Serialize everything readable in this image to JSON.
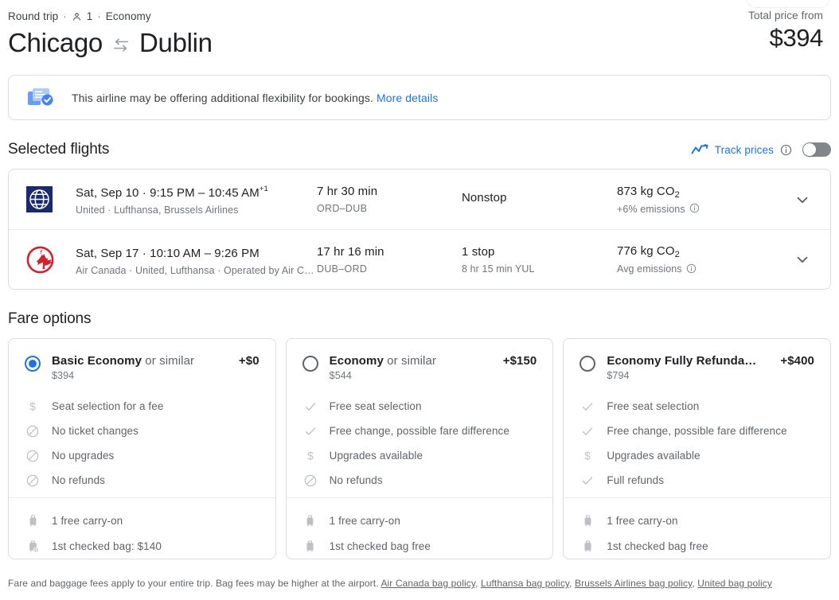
{
  "header": {
    "trip_type": "Round trip",
    "sep": "·",
    "passengers": "1",
    "cabin": "Economy",
    "origin": "Chicago",
    "destination": "Dublin",
    "swap_icon": "swap-arrows-icon",
    "person_icon": "person-icon",
    "total_price_label": "Total price from",
    "total_price": "$394"
  },
  "flex_banner": {
    "icon": "flexible-booking-icon",
    "text": "This airline may be offering additional flexibility for bookings.",
    "link_label": "More details"
  },
  "selected_flights": {
    "title": "Selected flights",
    "track_prices": {
      "icon": "trend-line-icon",
      "label": "Track prices",
      "info_icon": "info-icon",
      "toggle_state": "off"
    },
    "flights": [
      {
        "airline_logo": "united-airlines-logo",
        "date_and_time": "Sat, Sep 10  ·  9:15 PM – 10:45 AM",
        "next_day": "+1",
        "operators": "United · Lufthansa, Brussels Airlines",
        "duration": "7 hr 30 min",
        "airports": "ORD–DUB",
        "stops": "Nonstop",
        "stop_detail": "",
        "emissions": "873 kg CO",
        "emissions_sub_digit": "2",
        "emissions_note": "+6% emissions",
        "emissions_info_icon": "info-icon",
        "expand_icon": "chevron-down-icon"
      },
      {
        "airline_logo": "air-canada-logo",
        "date_and_time": "Sat, Sep 17  ·  10:10 AM – 9:26 PM",
        "next_day": "",
        "operators": "Air Canada · United, Lufthansa · Operated by Air C…",
        "duration": "17 hr 16 min",
        "airports": "DUB–ORD",
        "stops": "1 stop",
        "stop_detail": "8 hr 15 min YUL",
        "emissions": "776 kg CO",
        "emissions_sub_digit": "2",
        "emissions_note": "Avg emissions",
        "emissions_info_icon": "info-icon",
        "expand_icon": "chevron-down-icon"
      }
    ]
  },
  "fare_options": {
    "title": "Fare options",
    "cards": [
      {
        "selected": true,
        "name": "Basic Economy",
        "suffix": " or similar",
        "price": "$394",
        "delta": "+$0",
        "features": [
          {
            "icon": "dollar-icon",
            "text": "Seat selection for a fee"
          },
          {
            "icon": "no-entry-icon",
            "text": "No ticket changes"
          },
          {
            "icon": "no-entry-icon",
            "text": "No upgrades"
          },
          {
            "icon": "no-entry-icon",
            "text": "No refunds"
          }
        ],
        "bags": [
          {
            "icon": "carry-on-bag-icon",
            "text": "1 free carry-on"
          },
          {
            "icon": "checked-bag-fee-icon",
            "text": "1st checked bag: $140"
          }
        ]
      },
      {
        "selected": false,
        "name": "Economy",
        "suffix": " or similar",
        "price": "$544",
        "delta": "+$150",
        "features": [
          {
            "icon": "check-icon",
            "text": "Free seat selection"
          },
          {
            "icon": "check-icon",
            "text": "Free change, possible fare difference"
          },
          {
            "icon": "dollar-icon",
            "text": "Upgrades available"
          },
          {
            "icon": "no-entry-icon",
            "text": "No refunds"
          }
        ],
        "bags": [
          {
            "icon": "carry-on-bag-icon",
            "text": "1 free carry-on"
          },
          {
            "icon": "checked-bag-icon",
            "text": "1st checked bag free"
          }
        ]
      },
      {
        "selected": false,
        "name": "Economy Fully Refunda…",
        "suffix": "",
        "price": "$794",
        "delta": "+$400",
        "features": [
          {
            "icon": "check-icon",
            "text": "Free seat selection"
          },
          {
            "icon": "check-icon",
            "text": "Free change, possible fare difference"
          },
          {
            "icon": "dollar-icon",
            "text": "Upgrades available"
          },
          {
            "icon": "check-icon",
            "text": "Full refunds"
          }
        ],
        "bags": [
          {
            "icon": "carry-on-bag-icon",
            "text": "1 free carry-on"
          },
          {
            "icon": "checked-bag-icon",
            "text": "1st checked bag free"
          }
        ]
      }
    ]
  },
  "footer": {
    "text": "Fare and baggage fees apply to your entire trip. Bag fees may be higher at the airport.",
    "links": [
      "Air Canada bag policy",
      "Lufthansa bag policy",
      "Brussels Airlines bag policy",
      "United bag policy"
    ]
  },
  "colors": {
    "accent_blue": "#1a73e8",
    "text_primary": "#202124",
    "text_secondary": "#5f6368",
    "border": "#dadce0",
    "united_blue": "#1a2a6c",
    "air_canada_red": "#d8202d"
  }
}
